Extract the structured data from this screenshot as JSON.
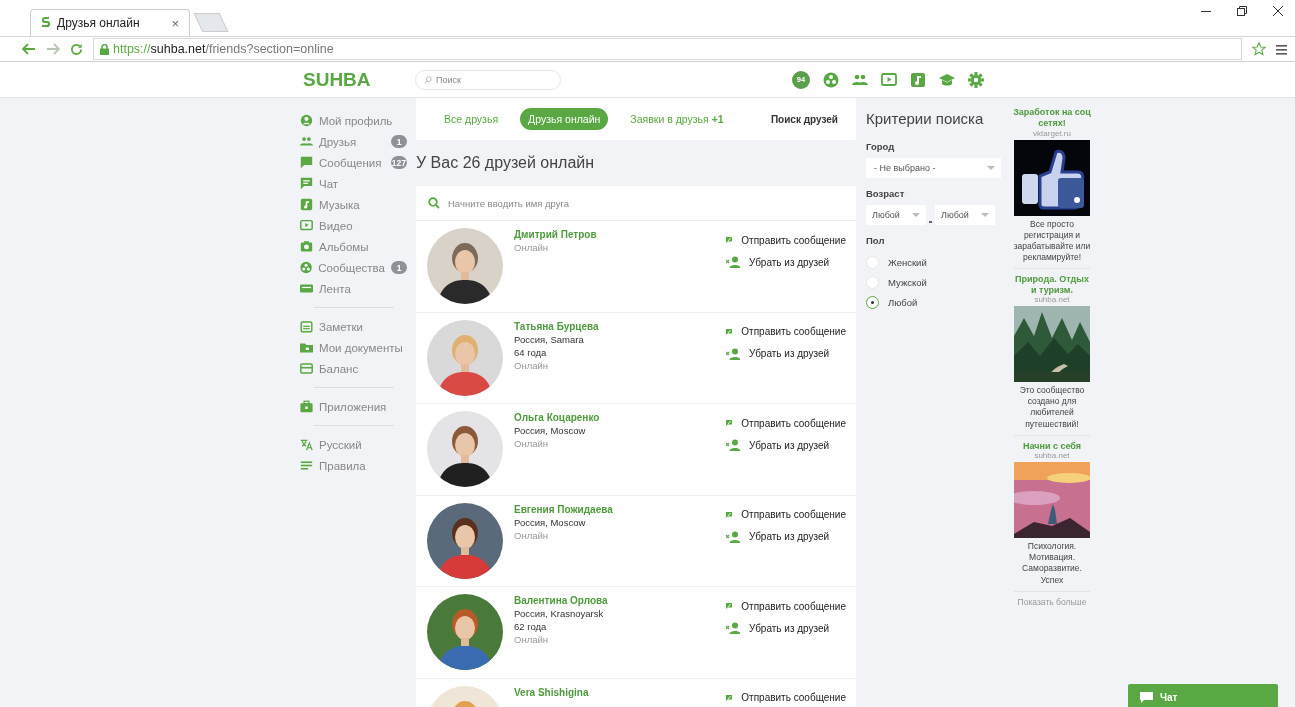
{
  "browser": {
    "tab_title": "Друзья онлайн",
    "tab_close": "×",
    "url_scheme": "https://",
    "url_host": "suhba.net",
    "url_path": "/friends?section=online"
  },
  "header": {
    "logo": "SUHBA",
    "search_placeholder": "Поиск",
    "notification_count": "94"
  },
  "sidebar": {
    "groups": [
      [
        {
          "label": "Мой профиль"
        },
        {
          "label": "Друзья",
          "badge": "1"
        },
        {
          "label": "Сообщения",
          "badge": "127"
        },
        {
          "label": "Чат"
        },
        {
          "label": "Музыка"
        },
        {
          "label": "Видео"
        },
        {
          "label": "Альбомы"
        },
        {
          "label": "Сообщества",
          "badge": "1"
        },
        {
          "label": "Лента"
        }
      ],
      [
        {
          "label": "Заметки"
        },
        {
          "label": "Мои документы"
        },
        {
          "label": "Баланс"
        }
      ],
      [
        {
          "label": "Приложения"
        }
      ],
      [
        {
          "label": "Русский"
        },
        {
          "label": "Правила"
        }
      ]
    ]
  },
  "tabs": [
    {
      "label": "Все друзья",
      "selected": false
    },
    {
      "label": "Друзья онлайн",
      "selected": true
    },
    {
      "label": "Заявки в друзья **+1**",
      "selected": false
    }
  ],
  "find_friends": "Поиск друзей",
  "heading": "У Вас 26 друзей онлайн",
  "friend_search": {
    "placeholder": "Начните вводить имя друга"
  },
  "friends": [
    {
      "name": "Дмитрий Петров",
      "status": "Онлайн",
      "actions": [
        {
          "kind": "message",
          "label": "Отправить сообщение"
        },
        {
          "kind": "remove",
          "label": "Убрать из друзей"
        }
      ]
    },
    {
      "name": "Татьяна Бурцева",
      "location": "Россия, Samara",
      "age": "64 года",
      "status": "Онлайн",
      "actions": [
        {
          "kind": "message",
          "label": "Отправить сообщение"
        },
        {
          "kind": "remove",
          "label": "Убрать из друзей"
        }
      ]
    },
    {
      "name": "Ольга Коцаренко",
      "location": "Россия, Moscow",
      "status": "Онлайн",
      "actions": [
        {
          "kind": "message",
          "label": "Отправить сообщение"
        },
        {
          "kind": "remove",
          "label": "Убрать из друзей"
        }
      ]
    },
    {
      "name": "Евгения Пожидаева",
      "location": "Россия, Moscow",
      "status": "Онлайн",
      "actions": [
        {
          "kind": "message",
          "label": "Отправить сообщение"
        },
        {
          "kind": "remove",
          "label": "Убрать из друзей"
        }
      ]
    },
    {
      "name": "Валентина Орлова",
      "location": "Россия, Krasnoyarsk",
      "age": "62 года",
      "status": "Онлайн",
      "actions": [
        {
          "kind": "message",
          "label": "Отправить сообщение"
        },
        {
          "kind": "remove",
          "label": "Убрать из друзей"
        }
      ]
    },
    {
      "name": "Vera Shishigina",
      "actions": [
        {
          "kind": "message",
          "label": "Отправить сообщение"
        }
      ]
    }
  ],
  "criteria": {
    "title": "Критерии поиска",
    "city_label": "Город",
    "city_value": "- Не выбрано -",
    "age_label": "Возраст",
    "age_from": "Любой",
    "age_to": "Любой",
    "gender_label": "Пол",
    "gender_options": [
      {
        "label": "Женский",
        "selected": false
      },
      {
        "label": "Мужской",
        "selected": false
      },
      {
        "label": "Любой",
        "selected": true
      }
    ]
  },
  "ads": [
    {
      "title": "Заработок на соц сетях!",
      "source": "vktarget.ru",
      "caption": "Все просто регистрация и зарабатывайте или рекламируйте!"
    },
    {
      "title": "Природа. Отдых и туризм.",
      "source": "suhba.net",
      "caption": "Это сообщество создано для любителей путешествий!"
    },
    {
      "title": "Начни с себя",
      "source": "suhba.net",
      "caption": "Психология. Мотивация. Саморазвитие. Успех"
    }
  ],
  "show_more": "Показать больше",
  "chat_button": "Чат"
}
